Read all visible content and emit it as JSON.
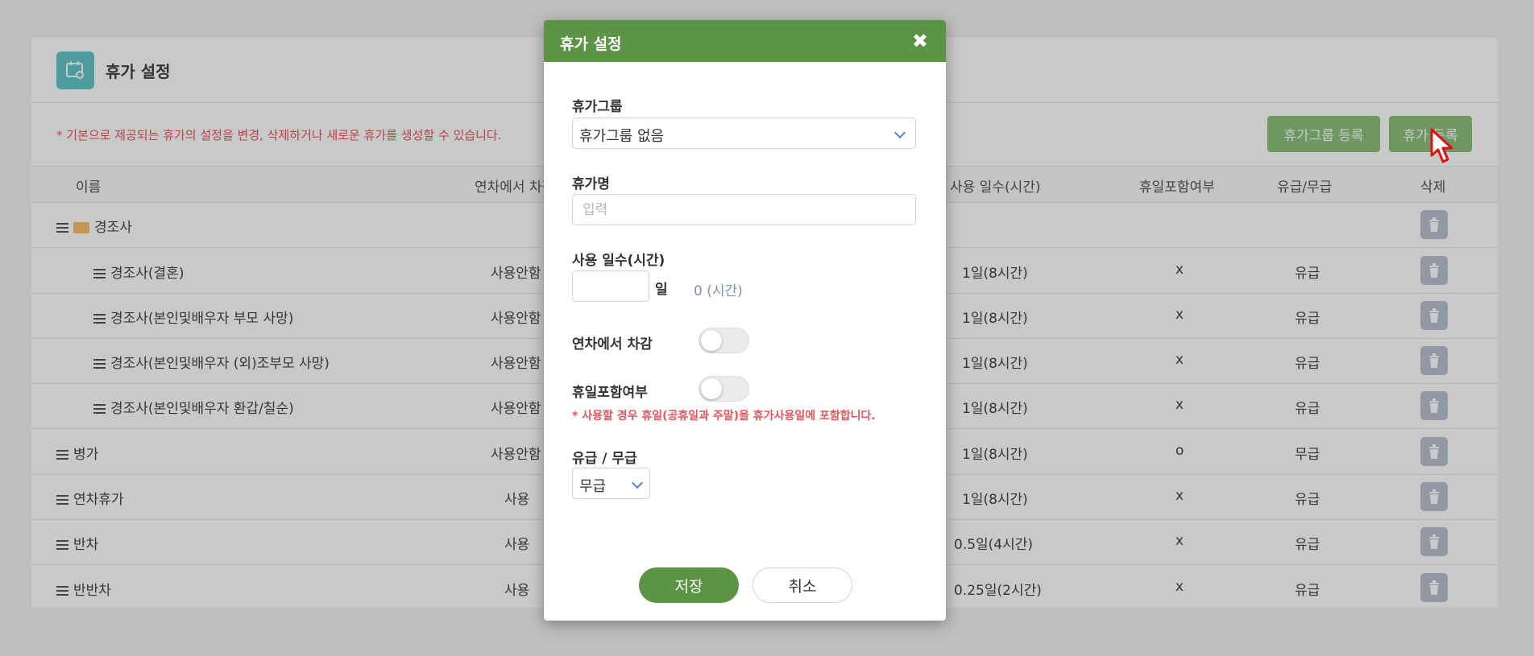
{
  "panel": {
    "title": "휴가 설정",
    "notice": "* 기본으로 제공되는 휴가의 설정을 변경, 삭제하거나 새로운 휴가를 생성할 수 있습니다.",
    "buttons": {
      "register_group": "휴가그룹 등록",
      "register_vacation": "휴가 등록"
    }
  },
  "table": {
    "headers": {
      "name": "이름",
      "deduct": "연차에서 차감",
      "days": "사용 일수(시간)",
      "holiday": "휴일포함여부",
      "paid": "유급/무급",
      "delete": "삭제"
    },
    "rows": [
      {
        "name": "경조사",
        "deduct": "",
        "days": "",
        "holiday": "",
        "paid": ""
      },
      {
        "name": "경조사(결혼)",
        "deduct": "사용안함",
        "days": "1일(8시간)",
        "holiday": "x",
        "paid": "유급"
      },
      {
        "name": "경조사(본인및배우자 부모 사망)",
        "deduct": "사용안함",
        "days": "1일(8시간)",
        "holiday": "x",
        "paid": "유급"
      },
      {
        "name": "경조사(본인및배우자 (외)조부모 사망)",
        "deduct": "사용안함",
        "days": "1일(8시간)",
        "holiday": "x",
        "paid": "유급"
      },
      {
        "name": "경조사(본인및배우자 환갑/칠순)",
        "deduct": "사용안함",
        "days": "1일(8시간)",
        "holiday": "x",
        "paid": "유급"
      },
      {
        "name": "병가",
        "deduct": "사용안함",
        "days": "1일(8시간)",
        "holiday": "o",
        "paid": "무급"
      },
      {
        "name": "연차휴가",
        "deduct": "사용",
        "days": "1일(8시간)",
        "holiday": "x",
        "paid": "유급"
      },
      {
        "name": "반차",
        "deduct": "사용",
        "days": "0.5일(4시간)",
        "holiday": "x",
        "paid": "유급"
      },
      {
        "name": "반반차",
        "deduct": "사용",
        "days": "0.25일(2시간)",
        "holiday": "x",
        "paid": "유급"
      }
    ]
  },
  "modal": {
    "title": "휴가 설정",
    "close": "✖",
    "group_label": "휴가그룹",
    "group_value": "휴가그룹 없음",
    "name_label": "휴가명",
    "name_placeholder": "입력",
    "days_label": "사용 일수(시간)",
    "days_unit": "일",
    "hours_display": "0 (시간)",
    "deduct_label": "연차에서 차감",
    "holiday_label": "휴일포함여부",
    "holiday_warning": "* 사용할 경우 휴일(공휴일과 주말)을 휴가사용일에 포함합니다.",
    "paid_label": "유급 / 무급",
    "paid_value": "무급",
    "save": "저장",
    "cancel": "취소"
  },
  "colors": {
    "modal_header": "#5b9445",
    "toolbar_button": "#8dc07d",
    "notice": "#e9545a"
  }
}
